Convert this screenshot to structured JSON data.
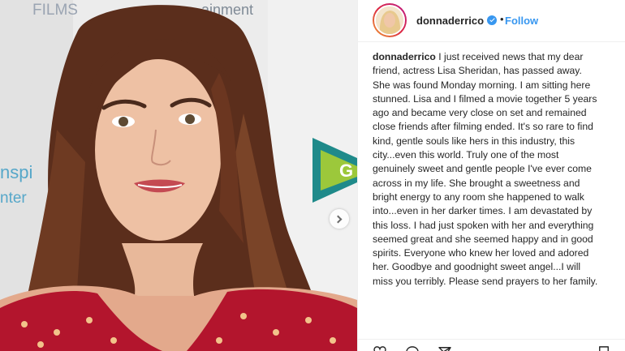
{
  "post": {
    "username": "donnaderrico",
    "follow_label": "Follow",
    "separator": "•",
    "caption_user": "donnaderrico",
    "caption_text": "I just received news that my dear friend, actress Lisa Sheridan, has passed away. She was found Monday morning. I am sitting here stunned. Lisa and I filmed a movie together 5 years ago and became very close on set and remained close friends after filming ended. It's so rare to find kind, gentle souls like hers in this industry, this city...even this world. Truly one of the most genuinely sweet and gentle people I've ever come across in my life. She brought a sweetness and bright energy to any room she happened to walk into...even in her darker times. I am devastated by this loss. I had just spoken with her and everything seemed great and she seemed happy and in good spirits. Everyone who knew her loved and adored her. Goodbye and goodnight sweet angel...I will miss you terribly. Please send prayers to her family."
  },
  "photo": {
    "backdrop_text_films": "FILMS",
    "backdrop_text_ainment": "ainment",
    "backdrop_text_nspi": "nspi",
    "backdrop_text_nter": "nter"
  },
  "colors": {
    "accent": "#3897f0",
    "text": "#262626",
    "border": "#efefef"
  },
  "icons": {
    "next": "chevron-right-icon",
    "verified": "verified-badge-icon",
    "like": "heart-icon",
    "comment": "comment-icon",
    "share": "share-icon",
    "save": "bookmark-icon"
  }
}
